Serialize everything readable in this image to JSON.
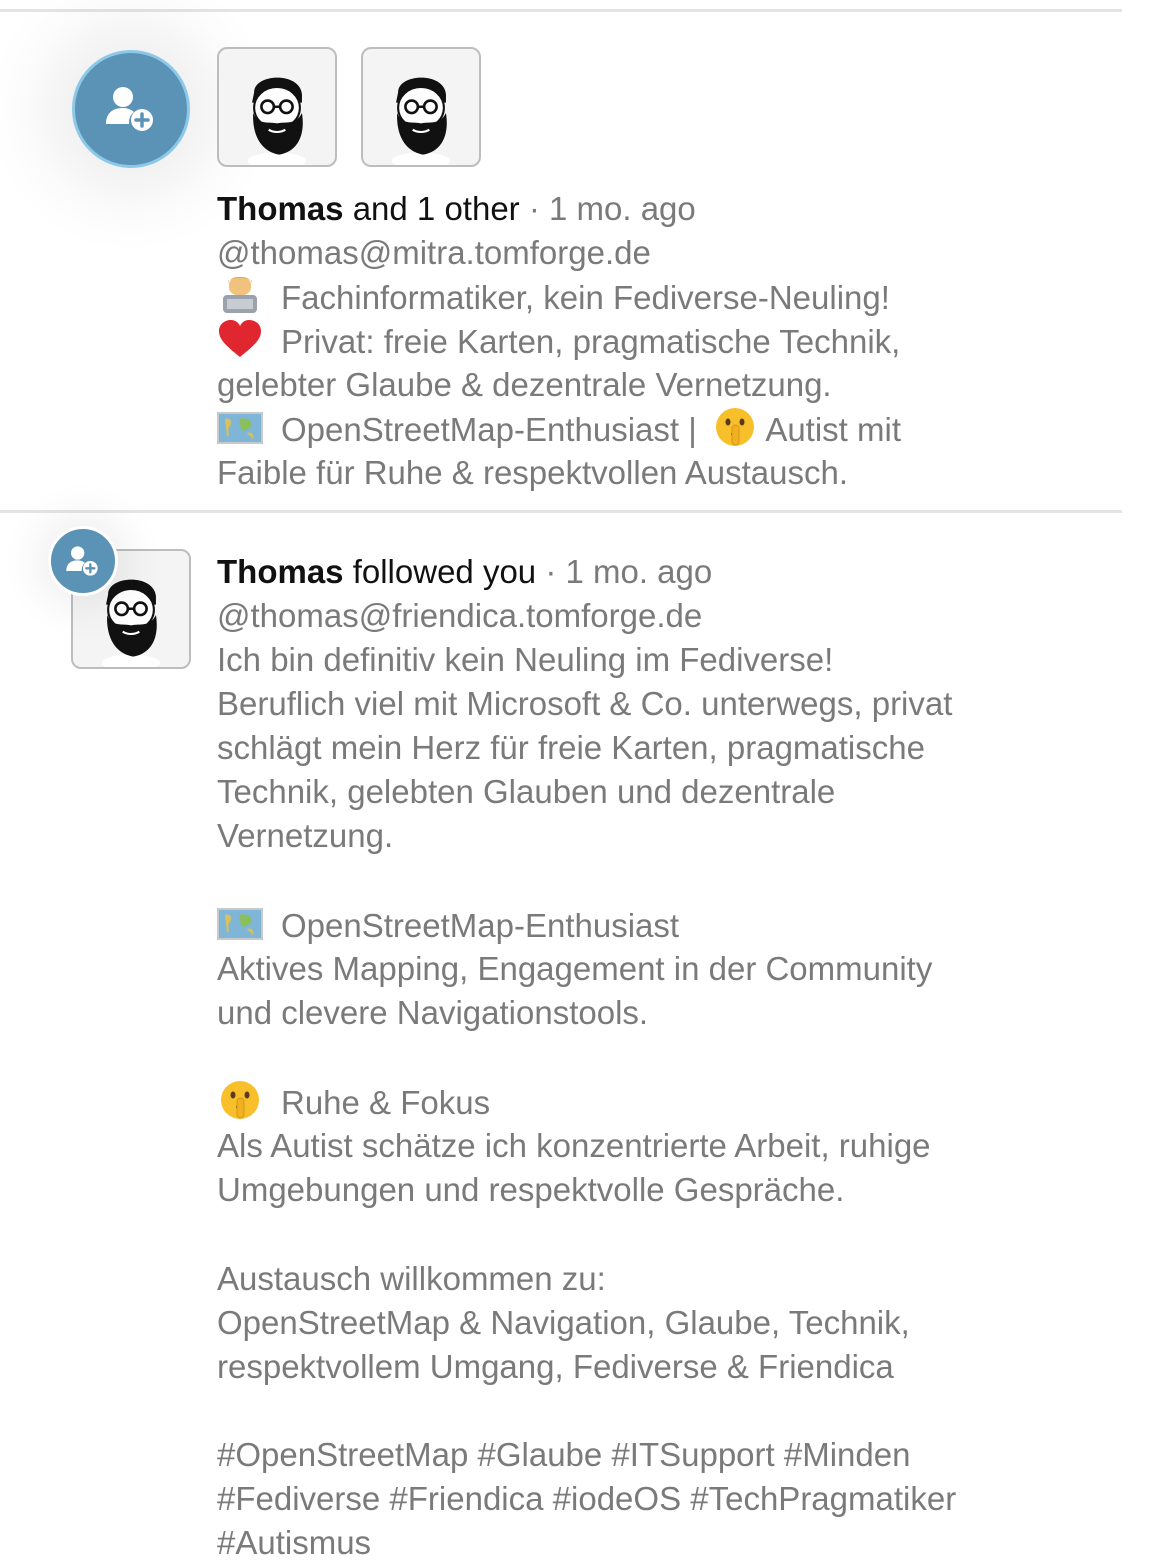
{
  "notification1": {
    "name": "Thomas",
    "rest": " and 1 other",
    "time": " · 1 mo. ago",
    "handle": "@thomas@mitra.tomforge.de",
    "bio_line1": "Fachinformatiker, kein Fediverse-Neuling!",
    "bio_line2": "Privat: freie Karten, pragmatische Technik,",
    "bio_line3": "gelebter Glaube & dezentrale Vernetzung.",
    "bio_line4a": "OpenStreetMap-Enthusiast | ",
    "bio_line4b": " Autist mit",
    "bio_line5": "Faible für Ruhe & respektvollen Austausch."
  },
  "notification2": {
    "name": "Thomas",
    "rest": " followed you",
    "time": " · 1 mo. ago",
    "handle": "@thomas@friendica.tomforge.de",
    "bio_p1": "Ich bin definitiv kein Neuling im Fediverse!\nBeruflich viel mit Microsoft & Co. unterwegs, privat\nschlägt mein Herz für freie Karten, pragmatische\nTechnik, gelebten Glauben und dezentrale\nVernetzung.",
    "osm_title": "OpenStreetMap-Enthusiast",
    "osm_text": "Aktives Mapping, Engagement in der Community\nund clevere Navigationstools.",
    "calm_title": "Ruhe & Fokus",
    "calm_text": "Als Autist schätze ich konzentrierte Arbeit, ruhige\nUmgebungen und respektvolle Gespräche.",
    "exchange": "Austausch willkommen zu:\nOpenStreetMap & Navigation, Glaube, Technik,\nrespektvollem Umgang, Fediverse & Friendica",
    "hashtags": "#OpenStreetMap #Glaube #ITSupport #Minden\n#Fediverse #Friendica #iodeOS #TechPragmatiker\n#Autismus"
  },
  "icons": {
    "follow": "person-add-icon",
    "avatar": "bearded-man-avatar",
    "technologist": "technologist-emoji",
    "heart": "red-heart-emoji",
    "map": "world-map-emoji",
    "shush": "shushing-face-emoji"
  },
  "colors": {
    "badge": "#5b93b6",
    "muted": "#7a7a7a"
  }
}
